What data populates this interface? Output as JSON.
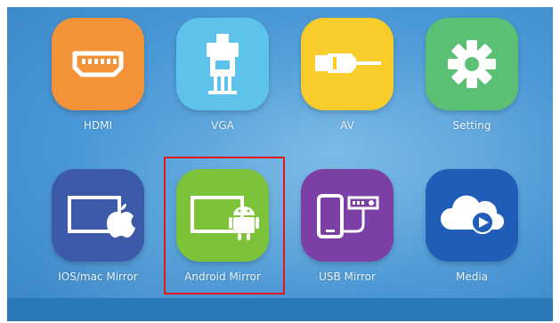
{
  "apps": [
    {
      "label": "HDMI",
      "icon": "hdmi-icon",
      "color": "#f4923a"
    },
    {
      "label": "VGA",
      "icon": "vga-icon",
      "color": "#5ec3ea"
    },
    {
      "label": "AV",
      "icon": "av-icon",
      "color": "#f8cc2a"
    },
    {
      "label": "Setting",
      "icon": "gear-icon",
      "color": "#5bbf74"
    },
    {
      "label": "IOS/mac Mirror",
      "icon": "ios-mirror-icon",
      "color": "#3c5aa8"
    },
    {
      "label": "Android Mirror",
      "icon": "android-mirror-icon",
      "color": "#7cc33a"
    },
    {
      "label": "USB Mirror",
      "icon": "usb-mirror-icon",
      "color": "#7b3fa6"
    },
    {
      "label": "Media",
      "icon": "cloud-media-icon",
      "color": "#1f5db8"
    }
  ],
  "selected": "Android Mirror",
  "highlight_color": "#e01818"
}
